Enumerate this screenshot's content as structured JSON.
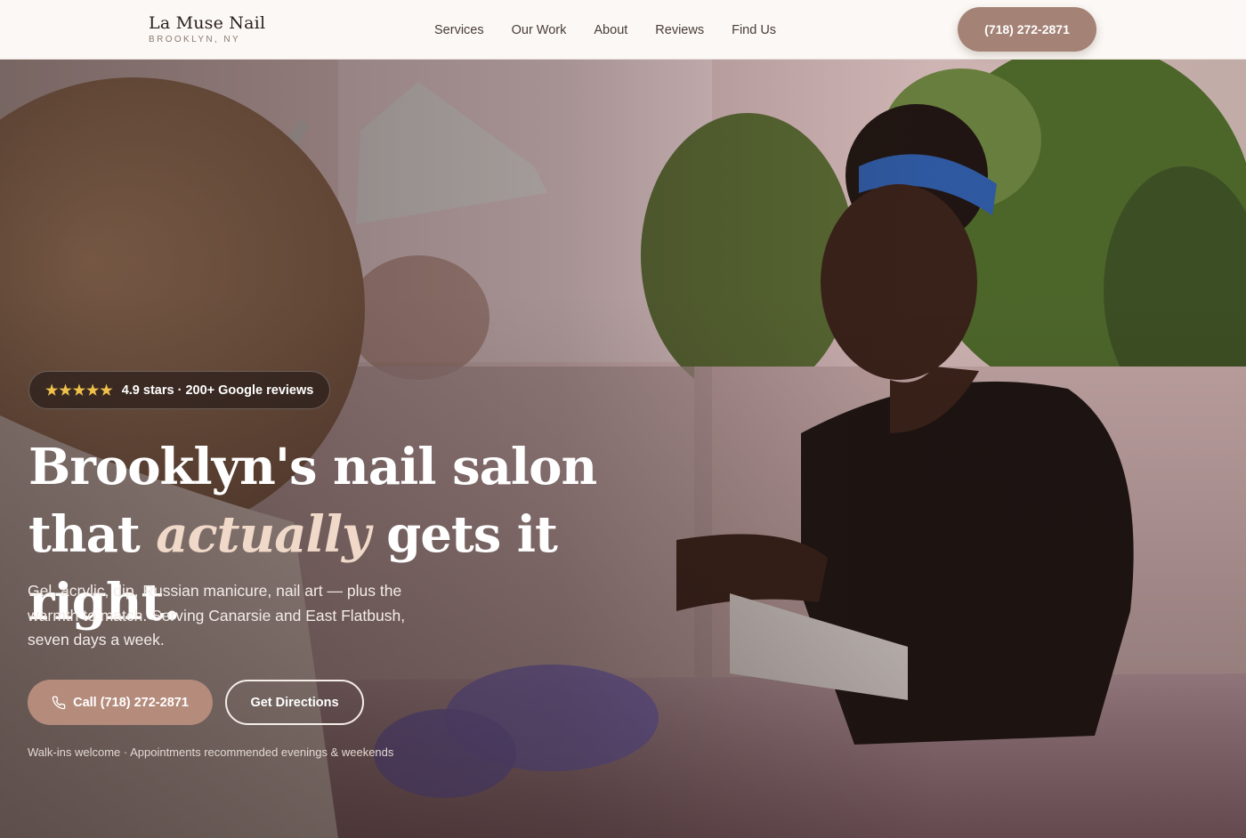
{
  "brand": {
    "name": "La Muse Nail",
    "location": "BROOKLYN, NY"
  },
  "nav": {
    "items": [
      {
        "label": "Services"
      },
      {
        "label": "Our Work"
      },
      {
        "label": "About"
      },
      {
        "label": "Reviews"
      },
      {
        "label": "Find Us"
      }
    ],
    "phone_button": "(718) 272-2871"
  },
  "hero": {
    "rating": {
      "stars_icon": "five-stars",
      "text": "4.9 stars · 200+ Google reviews"
    },
    "headline": {
      "line1": "Brooklyn's nail salon",
      "line2_before": "that ",
      "line2_emphasis": "actually",
      "line2_after": " gets it right."
    },
    "subtext": "Gel, acrylic, dip, Russian manicure, nail art — plus the warmth to match. Serving Canarsie and East Flatbush, seven days a week.",
    "call_button": "Call (718) 272-2871",
    "directions_button": "Get Directions",
    "note": "Walk-ins welcome · Appointments recommended evenings & weekends"
  },
  "colors": {
    "accent": "#a48276",
    "accent_button": "#b58b7b",
    "star": "#f0c24b",
    "header_bg": "#fbf8f5"
  }
}
